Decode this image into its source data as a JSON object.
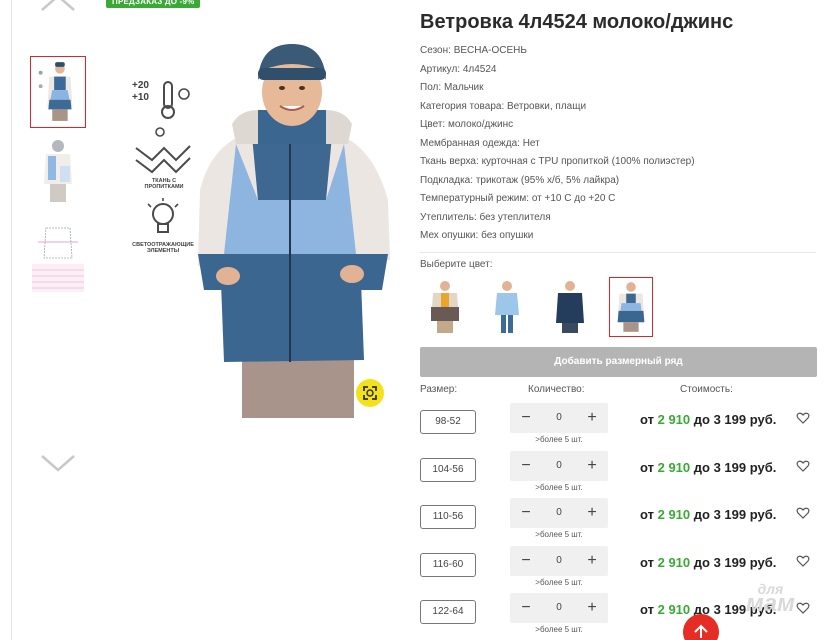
{
  "badge": "ПРЕДЗАКАЗ ДО -9%",
  "product": {
    "title": "Ветровка 4л4524 молоко/джинс"
  },
  "specs": [
    {
      "label": "Сезон:",
      "value": "ВЕСНА-ОСЕНЬ"
    },
    {
      "label": "Артикул:",
      "value": "4л4524"
    },
    {
      "label": "Пол:",
      "value": "Мальчик"
    },
    {
      "label": "Категория товара:",
      "value": "Ветровки, плащи"
    },
    {
      "label": "Цвет:",
      "value": "молоко/джинс"
    },
    {
      "label": "Мембранная одежда:",
      "value": "Нет"
    },
    {
      "label": "Ткань верха:",
      "value": "курточная с TPU пропиткой (100% полиэстер)"
    },
    {
      "label": "Подкладка:",
      "value": "трикотаж (95% х/б, 5% лайкра)"
    },
    {
      "label": "Температурный режим:",
      "value": "от +10 С до +20 С"
    },
    {
      "label": "Утеплитель:",
      "value": "без утеплителя"
    },
    {
      "label": "Мех опушки:",
      "value": "без опушки"
    }
  ],
  "features": {
    "temp_top": "+20",
    "temp_bottom": "+10",
    "fabric_label": "ТКАНЬ С ПРОПИТКАМИ",
    "reflective_label": "СВЕТООТРАЖАЮЩИЕ ЭЛЕМЕНТЫ"
  },
  "choose_color_label": "Выберите цвет:",
  "add_size_row_label": "Добавить размерный ряд",
  "columns": {
    "size": "Размер:",
    "quantity": "Количество:",
    "cost": "Стоимость:"
  },
  "stepper": {
    "minus": "−",
    "plus": "+"
  },
  "sizes": [
    {
      "size": "98-52",
      "qty": "0",
      "stock": ">более 5 шт.",
      "price_from_label": "от",
      "price_from": "2 910",
      "price_to": "до 3 199 руб."
    },
    {
      "size": "104-56",
      "qty": "0",
      "stock": ">более 5 шт.",
      "price_from_label": "от",
      "price_from": "2 910",
      "price_to": "до 3 199 руб."
    },
    {
      "size": "110-56",
      "qty": "0",
      "stock": ">более 5 шт.",
      "price_from_label": "от",
      "price_from": "2 910",
      "price_to": "до 3 199 руб."
    },
    {
      "size": "116-60",
      "qty": "0",
      "stock": ">более 5 шт.",
      "price_from_label": "от",
      "price_from": "2 910",
      "price_to": "до 3 199 руб."
    },
    {
      "size": "122-64",
      "qty": "0",
      "stock": ">более 5 шт.",
      "price_from_label": "от",
      "price_from": "2 910",
      "price_to": "до 3 199 руб."
    }
  ],
  "watermark": {
    "line1": "для",
    "line2": "мам"
  },
  "colors": {
    "accent_green": "#3aa935",
    "selection_red": "#d9252b",
    "button_grey": "#b4b4b4",
    "zoom_yellow": "#f3e21b"
  }
}
